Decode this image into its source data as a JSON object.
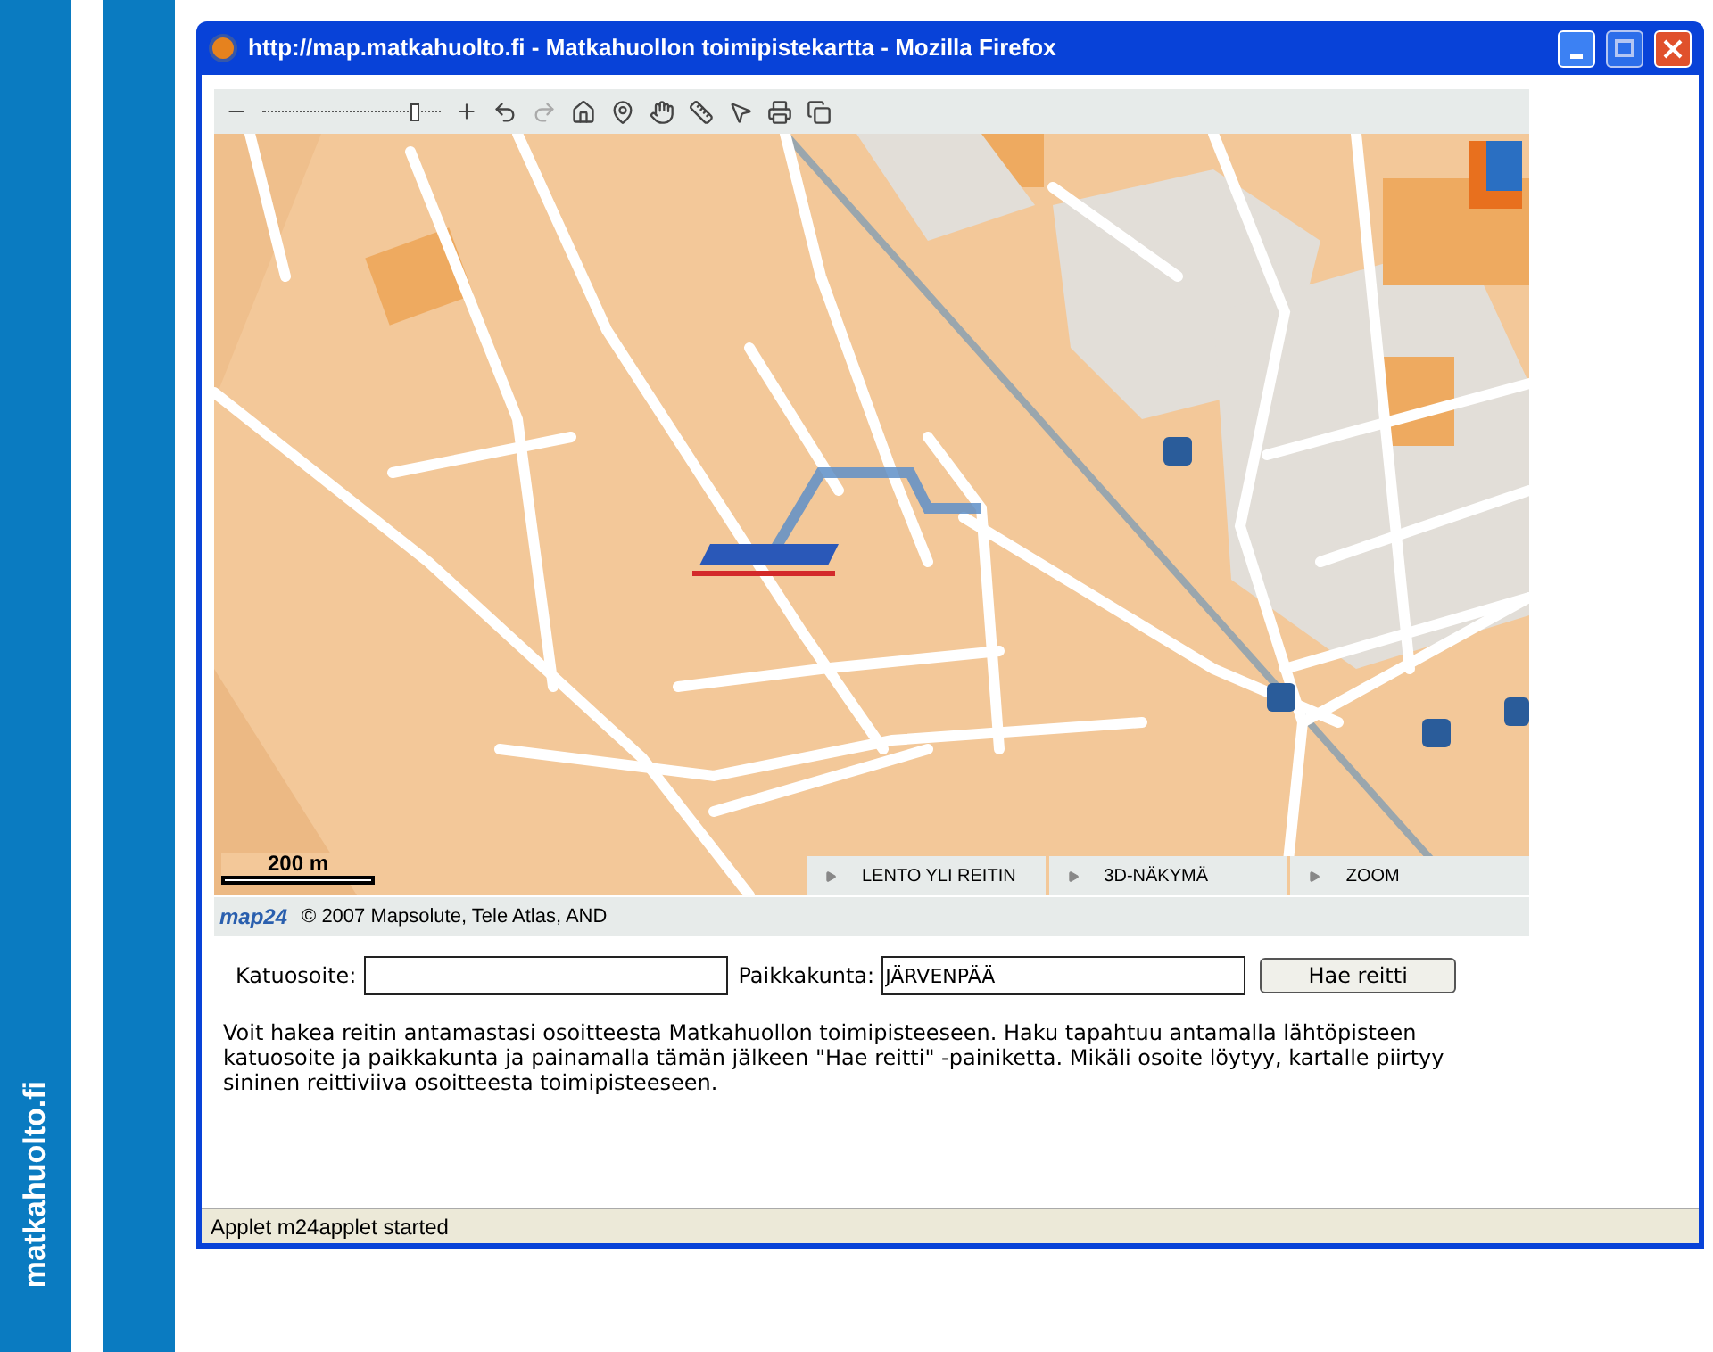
{
  "window": {
    "title": "http://map.matkahuolto.fi - Matkahuollon toimipistekartta - Mozilla Firefox"
  },
  "brand_stripe": {
    "text": "matkahuolto.fi"
  },
  "map": {
    "zoom": {
      "level": 0.86
    },
    "scale": "200 m",
    "actions": [
      "LENTO YLI REITIN",
      "3D-NÄKYMÄ",
      "ZOOM"
    ],
    "provider": "map24",
    "copyright": "© 2007 Mapsolute, Tele Atlas, AND"
  },
  "form": {
    "fields": [
      {
        "label": "Katuosoite:"
      },
      {
        "label": "Paikkakunta:",
        "value": "JÄRVENPÄÄ"
      }
    ],
    "button": "Hae reitti"
  },
  "info": "Voit hakea reitin antamastasi osoitteesta Matkahuollon toimipisteeseen. Haku tapahtuu antamalla lähtöpisteen katuosoite ja paikkakunta ja painamalla tämän jälkeen \"Hae reitti\" -painiketta. Mikäli osoite löytyy, kartalle piirtyy sininen reittiviiva osoitteesta toimipisteeseen.",
  "status_bar": "Applet m24applet started"
}
